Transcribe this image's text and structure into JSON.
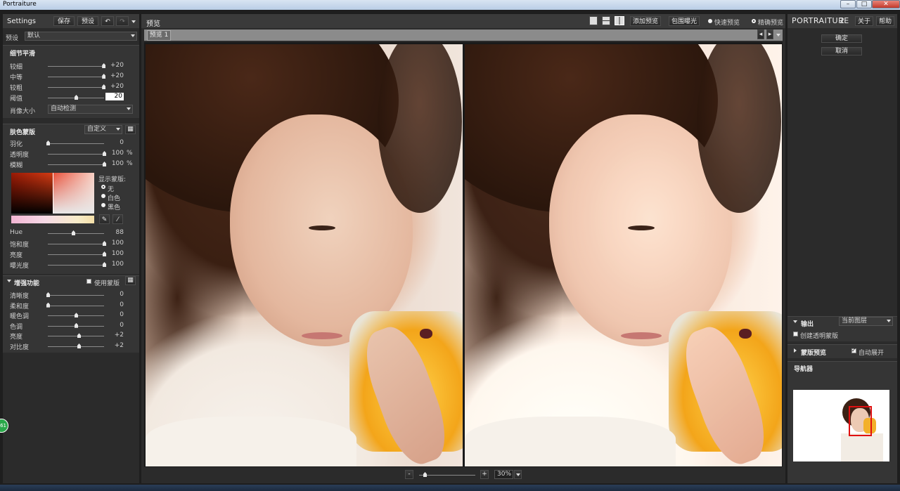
{
  "window": {
    "title": "Portraiture",
    "buttons": [
      "–",
      "□",
      "✕"
    ]
  },
  "left": {
    "settings_title": "Settings",
    "save_btn": "保存",
    "preset_btn": "预设",
    "undo_icon": "undo-icon",
    "redo_icon": "redo-icon",
    "preset_label": "预设",
    "preset_value": "默认",
    "detail_section": {
      "title": "细节平滑",
      "sliders": [
        {
          "label": "较细",
          "value": "+20",
          "level": 0.99
        },
        {
          "label": "中等",
          "value": "+20",
          "level": 0.99
        },
        {
          "label": "较粗",
          "value": "+20",
          "level": 0.99
        },
        {
          "label": "阈值",
          "value": "20",
          "level": 0.5
        }
      ],
      "portrait_size_label": "肖像大小",
      "portrait_size_value": "自动检测"
    },
    "skin_section": {
      "title": "肤色蒙版",
      "mode": "自定义",
      "sliders": [
        {
          "label": "羽化",
          "value": "0",
          "unit": "",
          "level": 0.0
        },
        {
          "label": "透明度",
          "value": "100",
          "unit": "%",
          "level": 1.0
        },
        {
          "label": "模糊",
          "value": "100",
          "unit": "%",
          "level": 1.0
        }
      ],
      "show_mask_label": "显示蒙版:",
      "show_mask_options": [
        "无",
        "白色",
        "黑色"
      ],
      "show_mask_selected": 0,
      "hsl": [
        {
          "label": "Hue",
          "value": "88",
          "level": 0.45
        },
        {
          "label": "饱和度",
          "value": "100",
          "level": 1.0
        },
        {
          "label": "亮度",
          "value": "100",
          "level": 1.0
        },
        {
          "label": "曝光度",
          "value": "100",
          "level": 1.0
        }
      ]
    },
    "enhance_section": {
      "title": "增强功能",
      "use_mask_label": "使用蒙版",
      "sliders": [
        {
          "label": "清晰度",
          "value": "0",
          "level": 0.0
        },
        {
          "label": "柔和度",
          "value": "0",
          "level": 0.0
        },
        {
          "label": "暖色调",
          "value": "0",
          "level": 0.5
        },
        {
          "label": "色调",
          "value": "0",
          "level": 0.5
        },
        {
          "label": "亮度",
          "value": "+2",
          "level": 0.55
        },
        {
          "label": "对比度",
          "value": "+2",
          "level": 0.55
        }
      ]
    }
  },
  "center": {
    "title": "预览",
    "add_preview": "添加预览",
    "clip_exposure": "包围曝光",
    "quick_preview": "快速预览",
    "accurate_preview": "精确预览",
    "preview_mode": "accurate",
    "tab_label": "预览 1",
    "zoom_minus": "-",
    "zoom_plus": "+",
    "zoom_value": "30%",
    "zoom_level": 0.1
  },
  "right": {
    "app_name": "PORTRAITURE",
    "app_version": "2",
    "about": "关于",
    "help": "帮助",
    "ok": "确定",
    "cancel": "取消",
    "output_label": "输出",
    "output_value": "当前图层",
    "create_mask_label": "创建透明蒙版",
    "mask_preview_label": "蒙版预览",
    "auto_expand_label": "自动展开",
    "navigator_label": "导航器"
  },
  "badge": "61"
}
